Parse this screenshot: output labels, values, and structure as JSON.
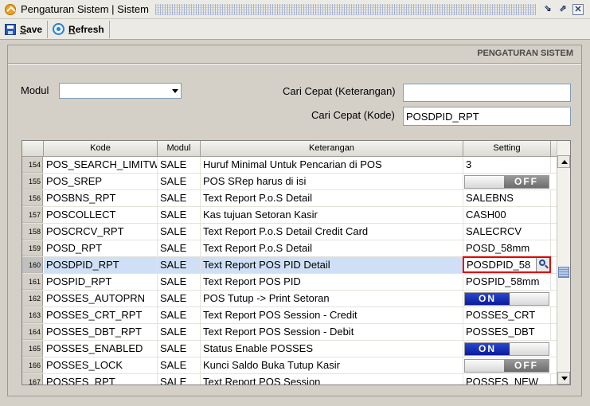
{
  "window": {
    "title": "Pengaturan Sistem | Sistem"
  },
  "toolbar": {
    "save": {
      "accel": "S",
      "rest": "ave"
    },
    "refresh": {
      "accel": "R",
      "rest": "efresh"
    }
  },
  "panel": {
    "heading": "PENGATURAN SISTEM",
    "modul_label": "Modul",
    "modul_value": "",
    "search_desc_label": "Cari Cepat (Keterangan)",
    "search_desc_value": "",
    "search_code_label": "Cari Cepat (Kode)",
    "search_code_value": "POSDPID_RPT"
  },
  "grid": {
    "columns": [
      "Kode",
      "Modul",
      "Keterangan",
      "Setting"
    ],
    "rows": [
      {
        "num": "154",
        "kode": "POS_SEARCH_LIMITW",
        "modul": "SALE",
        "ket": "Huruf Minimal Untuk Pencarian di POS",
        "setting": "3",
        "type": "text"
      },
      {
        "num": "155",
        "kode": "POS_SREP",
        "modul": "SALE",
        "ket": "POS SRep harus di isi",
        "setting": "OFF",
        "type": "off"
      },
      {
        "num": "156",
        "kode": "POSBNS_RPT",
        "modul": "SALE",
        "ket": "Text Report P.o.S Detail",
        "setting": "SALEBNS",
        "type": "text"
      },
      {
        "num": "157",
        "kode": "POSCOLLECT",
        "modul": "SALE",
        "ket": "Kas tujuan Setoran Kasir",
        "setting": "CASH00",
        "type": "text"
      },
      {
        "num": "158",
        "kode": "POSCRCV_RPT",
        "modul": "SALE",
        "ket": "Text Report P.o.S Detail Credit Card",
        "setting": "SALECRCV",
        "type": "text"
      },
      {
        "num": "159",
        "kode": "POSD_RPT",
        "modul": "SALE",
        "ket": "Text Report P.o.S Detail",
        "setting": "POSD_58mm",
        "type": "text"
      },
      {
        "num": "160",
        "kode": "POSDPID_RPT",
        "modul": "SALE",
        "ket": "Text Report POS PID Detail",
        "setting": "POSDPID_58",
        "type": "edit",
        "selected": true
      },
      {
        "num": "161",
        "kode": "POSPID_RPT",
        "modul": "SALE",
        "ket": "Text Report POS PID",
        "setting": "POSPID_58mm",
        "type": "text"
      },
      {
        "num": "162",
        "kode": "POSSES_AUTOPRN",
        "modul": "SALE",
        "ket": "POS Tutup -> Print Setoran",
        "setting": "ON",
        "type": "on"
      },
      {
        "num": "163",
        "kode": "POSSES_CRT_RPT",
        "modul": "SALE",
        "ket": "Text Report POS Session - Credit",
        "setting": "POSSES_CRT",
        "type": "text"
      },
      {
        "num": "164",
        "kode": "POSSES_DBT_RPT",
        "modul": "SALE",
        "ket": "Text Report POS Session - Debit",
        "setting": "POSSES_DBT",
        "type": "text"
      },
      {
        "num": "165",
        "kode": "POSSES_ENABLED",
        "modul": "SALE",
        "ket": "Status Enable POSSES",
        "setting": "ON",
        "type": "on"
      },
      {
        "num": "166",
        "kode": "POSSES_LOCK",
        "modul": "SALE",
        "ket": "Kunci Saldo Buka Tutup Kasir",
        "setting": "OFF",
        "type": "off"
      },
      {
        "num": "167",
        "kode": "POSSES_RPT",
        "modul": "SALE",
        "ket": "Text Report POS Session",
        "setting": "POSSES_NEW",
        "type": "text"
      }
    ]
  }
}
